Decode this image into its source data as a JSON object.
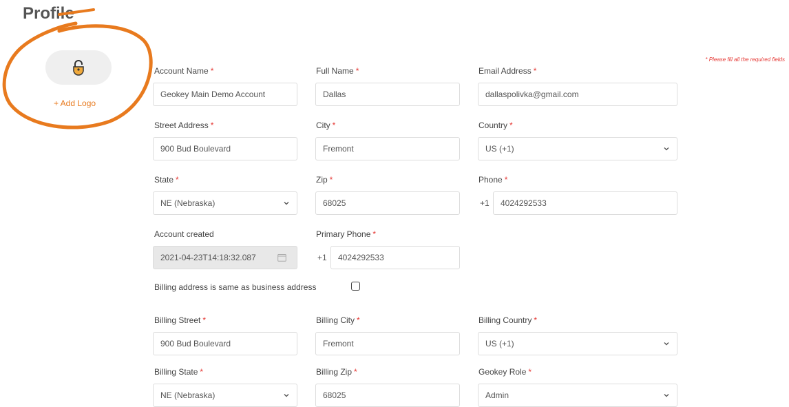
{
  "page": {
    "title": "Profile",
    "required_note": "* Please fill all the required fields"
  },
  "logo": {
    "add_label": "+ Add Logo"
  },
  "required_mark": "*",
  "fields": {
    "account_name": {
      "label": "Account Name",
      "value": "Geokey Main Demo Account"
    },
    "full_name": {
      "label": "Full Name",
      "value": "Dallas"
    },
    "email": {
      "label": "Email Address",
      "value": "dallaspolivka@gmail.com"
    },
    "street": {
      "label": "Street Address",
      "value": "900 Bud Boulevard"
    },
    "city": {
      "label": "City",
      "value": "Fremont"
    },
    "country": {
      "label": "Country",
      "value": "US (+1)"
    },
    "state": {
      "label": "State",
      "value": "NE (Nebraska)"
    },
    "zip": {
      "label": "Zip",
      "value": "68025"
    },
    "phone": {
      "label": "Phone",
      "prefix": "+1",
      "value": "4024292533"
    },
    "account_created": {
      "label": "Account created",
      "value": "2021-04-23T14:18:32.087"
    },
    "primary_phone": {
      "label": "Primary Phone",
      "prefix": "+1",
      "value": "4024292533"
    },
    "billing_same": {
      "label": "Billing address is same as business address",
      "checked": false
    },
    "billing_street": {
      "label": "Billing Street",
      "value": "900 Bud Boulevard"
    },
    "billing_city": {
      "label": "Billing City",
      "value": "Fremont"
    },
    "billing_country": {
      "label": "Billing Country",
      "value": "US (+1)"
    },
    "billing_state": {
      "label": "Billing State",
      "value": "NE (Nebraska)"
    },
    "billing_zip": {
      "label": "Billing Zip",
      "value": "68025"
    },
    "geokey_role": {
      "label": "Geokey Role",
      "value": "Admin"
    }
  },
  "colors": {
    "accent": "#e87a1e",
    "required": "#e53935",
    "lock_fill": "#f0a93b"
  },
  "icons": {
    "logo": "lock-icon",
    "select": "chevron-down-icon",
    "date": "calendar-icon"
  }
}
